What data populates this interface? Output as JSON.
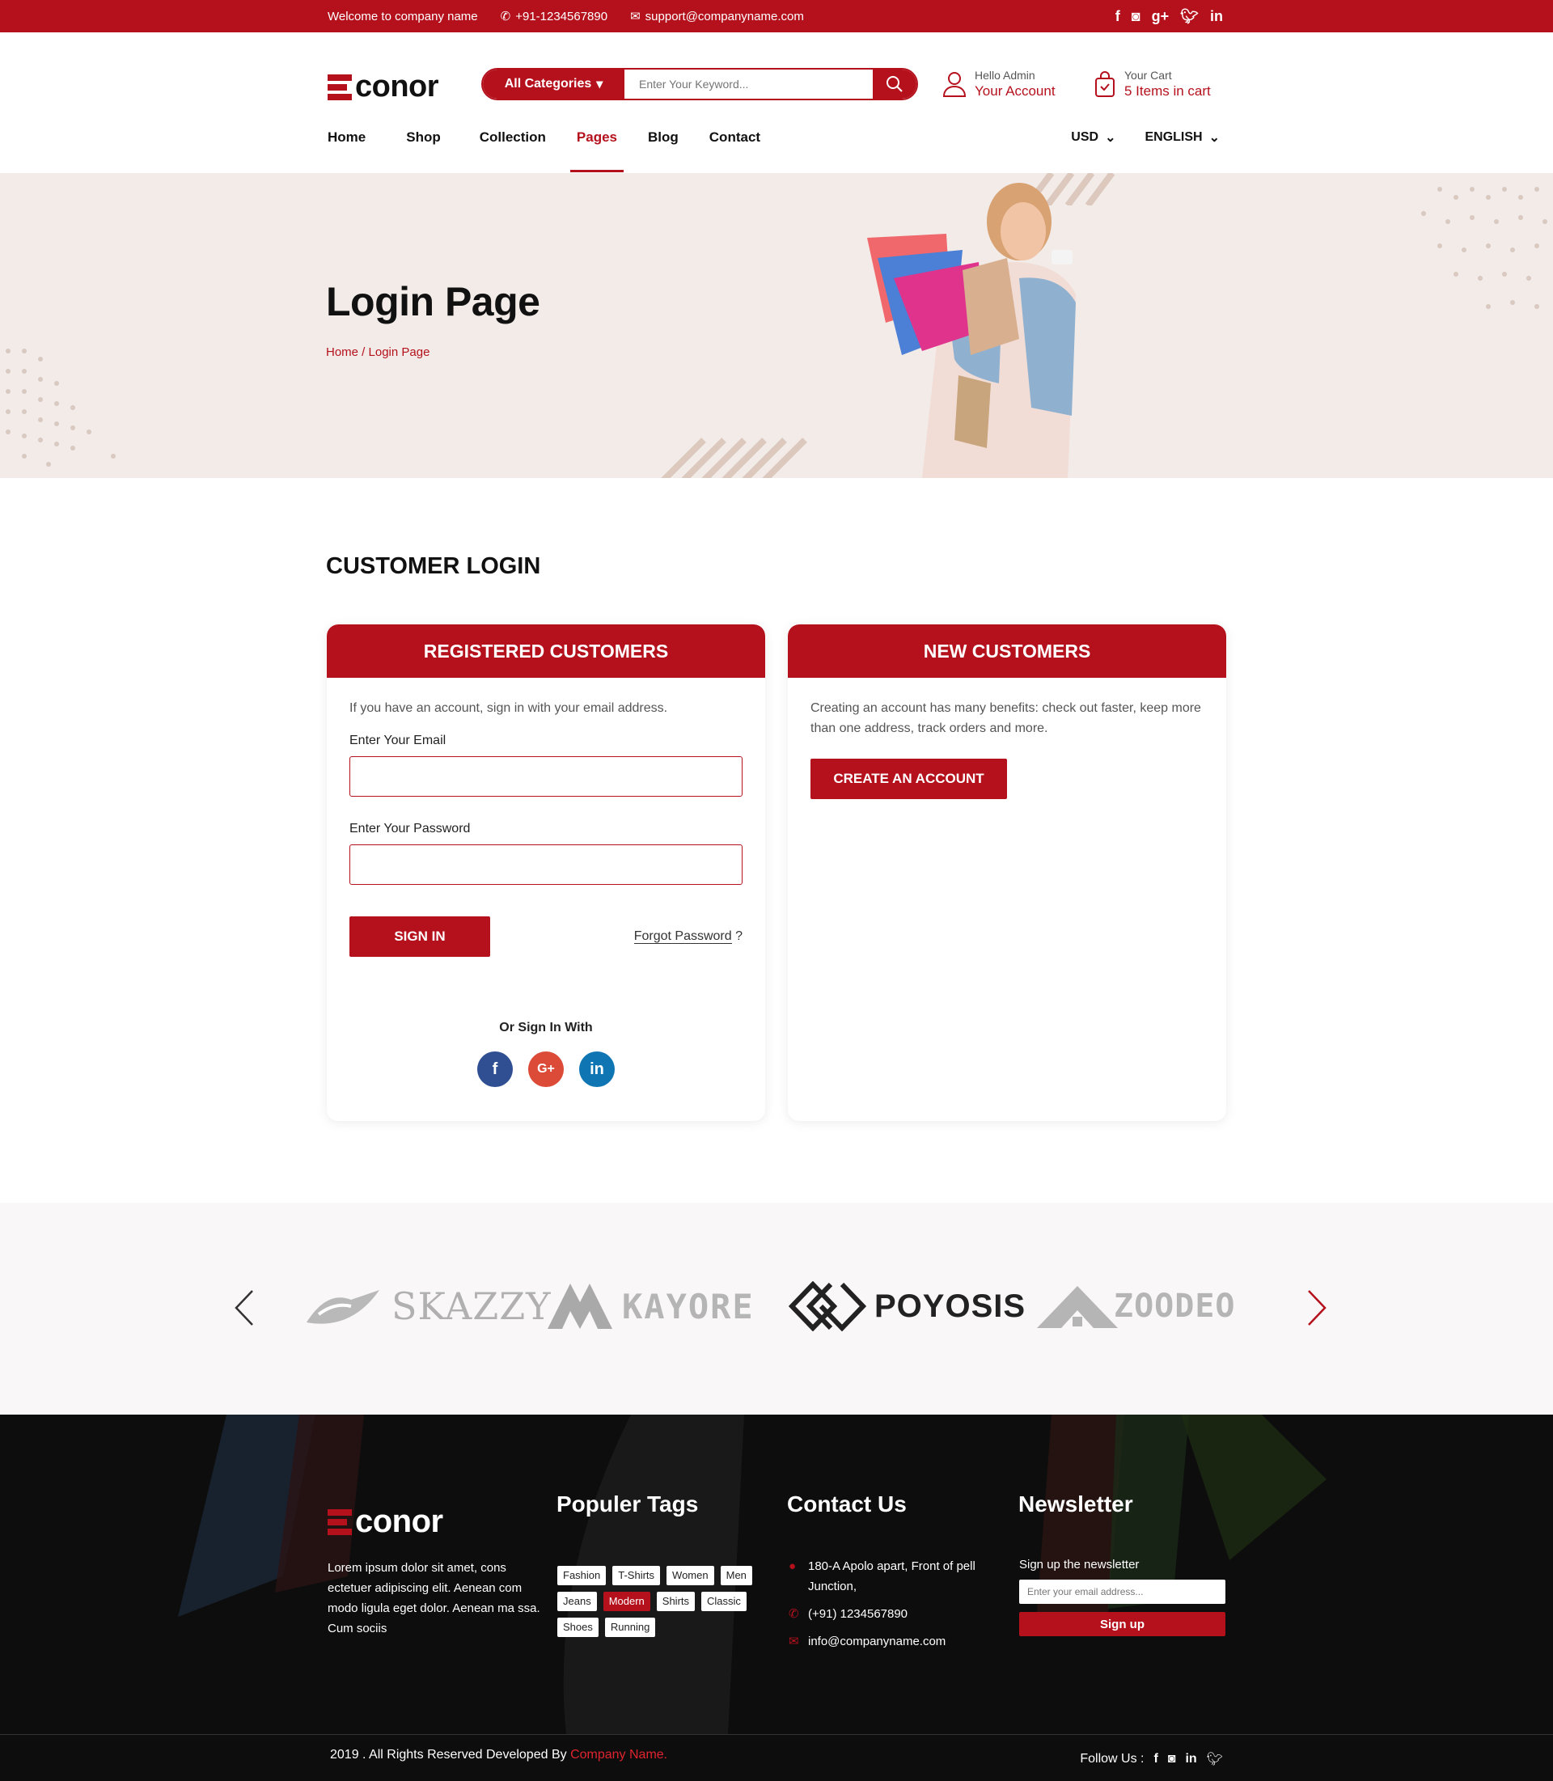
{
  "topbar": {
    "welcome": "Welcome to company name",
    "phone": "+91-1234567890",
    "email": "support@companyname.com",
    "social_icons": [
      "facebook-icon",
      "instagram-icon",
      "google-plus-icon",
      "twitter-icon",
      "linkedin-icon"
    ]
  },
  "header": {
    "logo_text": "conor",
    "search": {
      "category": "All Categories",
      "placeholder": "Enter Your Keyword..."
    },
    "account": {
      "greeting": "Hello Admin",
      "link": "Your Account"
    },
    "cart": {
      "label": "Your Cart",
      "items": "5 Items in cart"
    }
  },
  "nav": {
    "items": [
      "Home",
      "Shop",
      "Collection",
      "Pages",
      "Blog",
      "Contact"
    ],
    "active": "Pages",
    "currency": "USD",
    "language": "ENGLISH"
  },
  "hero": {
    "title": "Login Page",
    "breadcrumb_home": "Home",
    "breadcrumb_sep": " / ",
    "breadcrumb_current": "Login Page"
  },
  "login": {
    "section_title": "CUSTOMER LOGIN",
    "registered": {
      "heading": "REGISTERED CUSTOMERS",
      "intro": "If you have an account, sign in with your email address.",
      "email_label": "Enter Your Email",
      "password_label": "Enter Your Password",
      "signin_button": "SIGN IN",
      "forgot_link": "Forgot Password",
      "forgot_suffix": " ?",
      "or_signin": "Or Sign In With"
    },
    "new": {
      "heading": "NEW CUSTOMERS",
      "intro": "Creating an account has many benefits: check out faster, keep more than one address, track orders and more.",
      "create_button": "CREATE AN ACCOUNT"
    }
  },
  "brands": [
    "SKAZZY",
    "KAYORE",
    "POYOSIS",
    "ZOODEO"
  ],
  "footer": {
    "logo_text": "conor",
    "about": "Lorem ipsum dolor sit amet, cons ectetuer adipiscing elit. Aenean com modo ligula eget dolor. Aenean ma ssa. Cum sociis",
    "tags_title": "Populer Tags",
    "tags": [
      "Fashion",
      "T-Shirts",
      "Women",
      "Men",
      "Jeans",
      "Modern",
      "Shirts",
      "Classic",
      "Shoes",
      "Running"
    ],
    "highlight_tag": "Modern",
    "contact_title": "Contact Us",
    "address": "180-A Apolo apart, Front of pell Junction,",
    "phone": "(+91) 1234567890",
    "email": "info@companyname.com",
    "newsletter_title": "Newsletter",
    "newsletter_text": "Sign up the newsletter",
    "newsletter_placeholder": "Enter your email address...",
    "signup_button": "Sign up",
    "copyright_prefix": "2019 . All Rights Reserved Developed By ",
    "copyright_company": "Company Name.",
    "follow_label": "Follow Us :"
  },
  "colors": {
    "accent": "#b5111d",
    "hero_bg": "#f2ebe8",
    "footer_bg": "#0d0d0d"
  }
}
